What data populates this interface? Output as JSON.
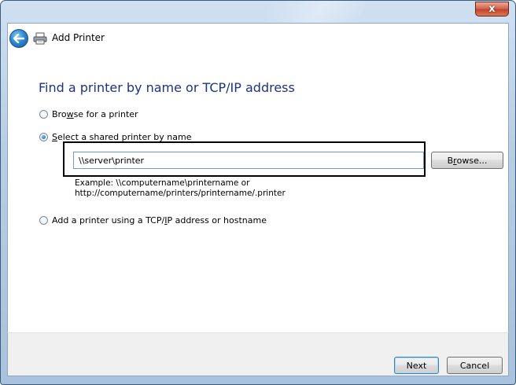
{
  "window": {
    "title": "Add Printer",
    "close_label": "x"
  },
  "heading": "Find a printer by name or TCP/IP address",
  "options": [
    {
      "pre": "Bro",
      "key": "w",
      "post": "se for a printer",
      "checked": false
    },
    {
      "pre": "",
      "key": "S",
      "post": "elect a shared printer by name",
      "checked": true
    },
    {
      "pre": "Add a printer using a TCP/",
      "key": "I",
      "post": "P address or hostname",
      "checked": false
    }
  ],
  "name_field": {
    "value": "\\\\server\\printer"
  },
  "browse_button": {
    "pre": "B",
    "key": "r",
    "post": "owse..."
  },
  "example": {
    "line1": "Example: \\\\computername\\printername or",
    "line2": "http://computername/printers/printername/.printer"
  },
  "footer": {
    "next_label": "Next",
    "cancel_label": "Cancel"
  },
  "colors": {
    "heading": "#1e3287",
    "frame": "#b7cde4"
  },
  "icons": {
    "back": "back-arrow-icon",
    "printer": "printer-icon",
    "close": "close-icon"
  }
}
